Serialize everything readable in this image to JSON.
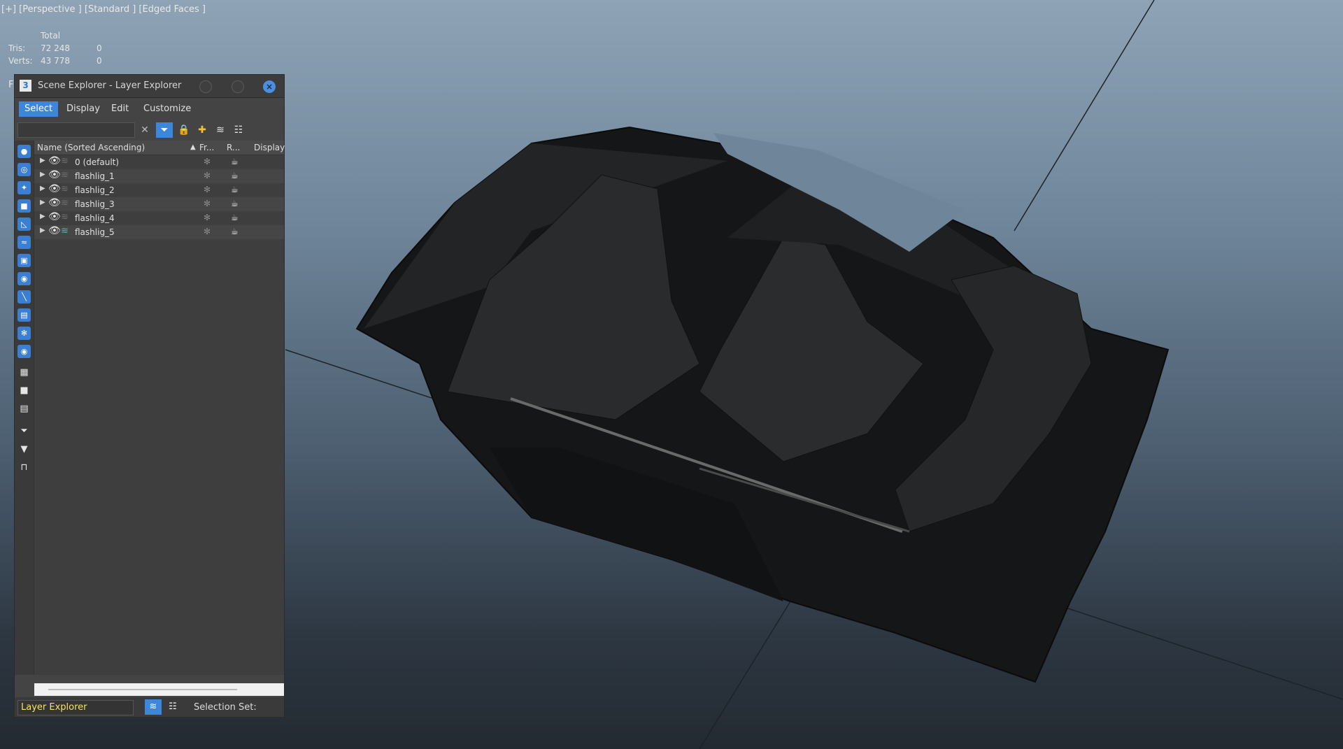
{
  "viewport": {
    "label": "[+] [Perspective ] [Standard ] [Edged Faces ]",
    "stats": {
      "header": "Total",
      "rows": [
        {
          "label": "Tris:",
          "total": "72 248",
          "selected": "0"
        },
        {
          "label": "Verts:",
          "total": "43 778",
          "selected": "0"
        }
      ]
    },
    "f_label": "F"
  },
  "panel": {
    "app_icon": "3",
    "title": "Scene Explorer - Layer Explorer",
    "menus": [
      "Select",
      "Display",
      "Edit",
      "Customize"
    ],
    "active_menu": "Select",
    "search_placeholder": "",
    "columns": {
      "name": "Name (Sorted Ascending)",
      "sort": "▲",
      "freeze": "Fr...",
      "render": "R...",
      "display": "Display"
    },
    "layers": [
      {
        "name": "0 (default)",
        "current": false
      },
      {
        "name": "flashlig_1",
        "current": false
      },
      {
        "name": "flashlig_2",
        "current": false
      },
      {
        "name": "flashlig_3",
        "current": false
      },
      {
        "name": "flashlig_4",
        "current": false
      },
      {
        "name": "flashlig_5",
        "current": true
      }
    ],
    "explorer_name": "Layer Explorer",
    "selection_set_label": "Selection Set:"
  },
  "icons": {
    "clear": "close-icon",
    "filter": "filter-icon",
    "lock": "lock-icon",
    "add_layer": "add-layer-icon",
    "layers": "layers-icon",
    "hierarchy": "hierarchy-icon"
  },
  "colors": {
    "accent": "#3d86dc",
    "current_layer": "#3fc0b8",
    "explorer_name": "#f5e26a"
  }
}
